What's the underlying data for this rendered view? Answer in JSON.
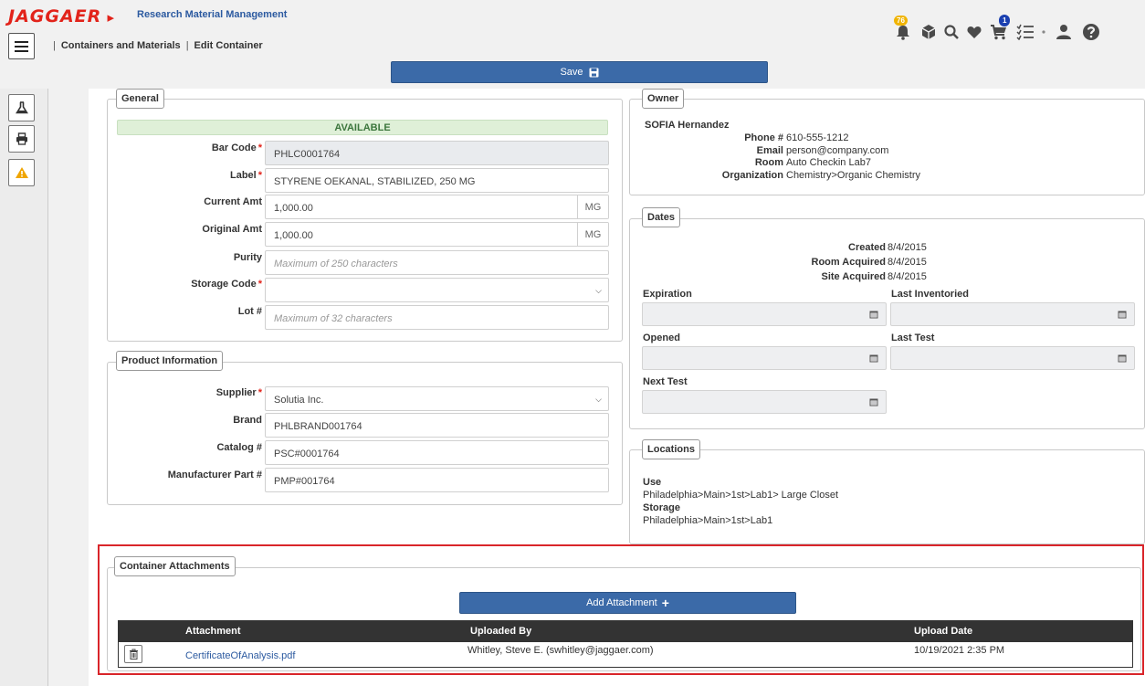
{
  "header": {
    "logo": "JAGGAER",
    "app_title": "Research Material Management",
    "breadcrumb": [
      "Containers and Materials",
      "Edit Container"
    ],
    "alerts_badge": "76",
    "cart_badge": "1"
  },
  "toolbar": {
    "save_label": "Save"
  },
  "general": {
    "legend": "General",
    "status": "AVAILABLE",
    "bar_code_label": "Bar Code",
    "bar_code": "PHLC0001764",
    "label_label": "Label",
    "label_value": "STYRENE OEKANAL, STABILIZED, 250 MG",
    "current_amt_label": "Current Amt",
    "current_amt": "1,000.00",
    "current_unit": "MG",
    "original_amt_label": "Original Amt",
    "original_amt": "1,000.00",
    "original_unit": "MG",
    "purity_label": "Purity",
    "purity_placeholder": "Maximum of 250 characters",
    "storage_code_label": "Storage Code",
    "storage_code": "",
    "lot_label": "Lot #",
    "lot_placeholder": "Maximum of 32 characters"
  },
  "product": {
    "legend": "Product Information",
    "supplier_label": "Supplier",
    "supplier": "Solutia Inc.",
    "brand_label": "Brand",
    "brand": "PHLBRAND001764",
    "catalog_label": "Catalog #",
    "catalog": "PSC#0001764",
    "mpn_label": "Manufacturer Part #",
    "mpn": "PMP#001764"
  },
  "owner": {
    "legend": "Owner",
    "name": "SOFIA Hernandez",
    "phone_label": "Phone #",
    "phone": "610-555-1212",
    "email_label": "Email",
    "email": "person@company.com",
    "room_label": "Room",
    "room": "Auto Checkin Lab7",
    "org_label": "Organization",
    "org": "Chemistry>Organic Chemistry"
  },
  "dates": {
    "legend": "Dates",
    "created_label": "Created",
    "created": "8/4/2015",
    "room_acquired_label": "Room Acquired",
    "room_acquired": "8/4/2015",
    "site_acquired_label": "Site Acquired",
    "site_acquired": "8/4/2015",
    "expiration_label": "Expiration",
    "last_inventoried_label": "Last Inventoried",
    "opened_label": "Opened",
    "last_test_label": "Last Test",
    "next_test_label": "Next Test"
  },
  "locations": {
    "legend": "Locations",
    "use_label": "Use",
    "use": "Philadelphia>Main>1st>Lab1> Large Closet",
    "storage_label": "Storage",
    "storage": "Philadelphia>Main>1st>Lab1"
  },
  "attachments": {
    "legend": "Container Attachments",
    "add_label": "Add Attachment",
    "columns": [
      "Attachment",
      "Uploaded By",
      "Upload Date"
    ],
    "rows": [
      {
        "file": "CertificateOfAnalysis.pdf",
        "uploaded_by": "Whitley, Steve E. (swhitley@jaggaer.com)",
        "date": "10/19/2021 2:35 PM"
      }
    ]
  },
  "colors": {
    "brand_red": "#e2231a",
    "primary": "#3b6aa8",
    "highlight_border": "#d9252a"
  }
}
